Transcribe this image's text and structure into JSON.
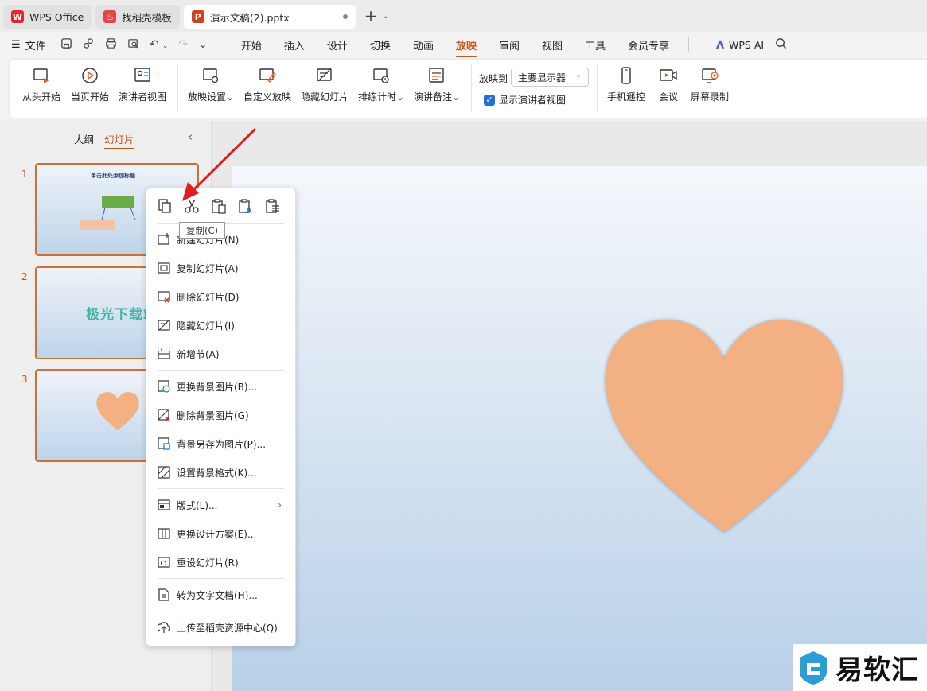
{
  "tabs": [
    {
      "label": "WPS Office",
      "logo": "W",
      "logo_color": "#e02b2b"
    },
    {
      "label": "找稻壳模板",
      "logo": "♨",
      "logo_color": "#e24848"
    },
    {
      "label": "演示文稿(2).pptx",
      "logo": "P",
      "logo_color": "#d1421c"
    }
  ],
  "new_tab": "+",
  "menubar": {
    "file": "文件",
    "items": [
      "开始",
      "插入",
      "设计",
      "切换",
      "动画",
      "放映",
      "审阅",
      "视图",
      "工具",
      "会员专享"
    ],
    "active": "放映",
    "wps_ai": "WPS AI"
  },
  "ribbon": {
    "from_start": "从头开始",
    "from_current": "当页开始",
    "presenter_view": "演讲者视图",
    "show_settings": "放映设置",
    "custom_show": "自定义放映",
    "hide_slide": "隐藏幻灯片",
    "rehearse": "排练计时",
    "speaker_notes": "演讲备注",
    "show_to_label": "放映到",
    "show_to_value": "主要显示器",
    "show_presenter_label": "显示演讲者视图",
    "phone_remote": "手机遥控",
    "meeting": "会议",
    "screen_record": "屏幕录制"
  },
  "panel": {
    "outline_tab": "大纲",
    "slides_tab": "幻灯片",
    "slides": [
      {
        "num": "1",
        "title": "单击此处添加标题"
      },
      {
        "num": "2",
        "text": "极光下载站"
      },
      {
        "num": "3"
      }
    ]
  },
  "context_menu": {
    "tooltip": "复制(C)",
    "items": [
      {
        "label": "新建幻灯片(N)",
        "icon": "new-slide-icon"
      },
      {
        "label": "复制幻灯片(A)",
        "icon": "duplicate-slide-icon"
      },
      {
        "label": "删除幻灯片(D)",
        "icon": "delete-slide-icon"
      },
      {
        "label": "隐藏幻灯片(I)",
        "icon": "hide-slide-icon"
      },
      {
        "label": "新增节(A)",
        "icon": "add-section-icon"
      },
      {
        "label": "更换背景图片(B)...",
        "icon": "change-bg-icon"
      },
      {
        "label": "删除背景图片(G)",
        "icon": "delete-bg-icon"
      },
      {
        "label": "背景另存为图片(P)...",
        "icon": "save-bg-icon"
      },
      {
        "label": "设置背景格式(K)...",
        "icon": "bg-format-icon"
      },
      {
        "label": "版式(L)...",
        "icon": "layout-icon"
      },
      {
        "label": "更换设计方案(E)...",
        "icon": "design-icon"
      },
      {
        "label": "重设幻灯片(R)",
        "icon": "reset-slide-icon"
      },
      {
        "label": "转为文字文档(H)...",
        "icon": "to-doc-icon"
      },
      {
        "label": "上传至稻壳资源中心(Q)",
        "icon": "upload-icon"
      }
    ]
  },
  "watermark": "易软汇",
  "colors": {
    "accent": "#c5541b",
    "heart": "#f2b083",
    "arrow": "#e02020"
  }
}
